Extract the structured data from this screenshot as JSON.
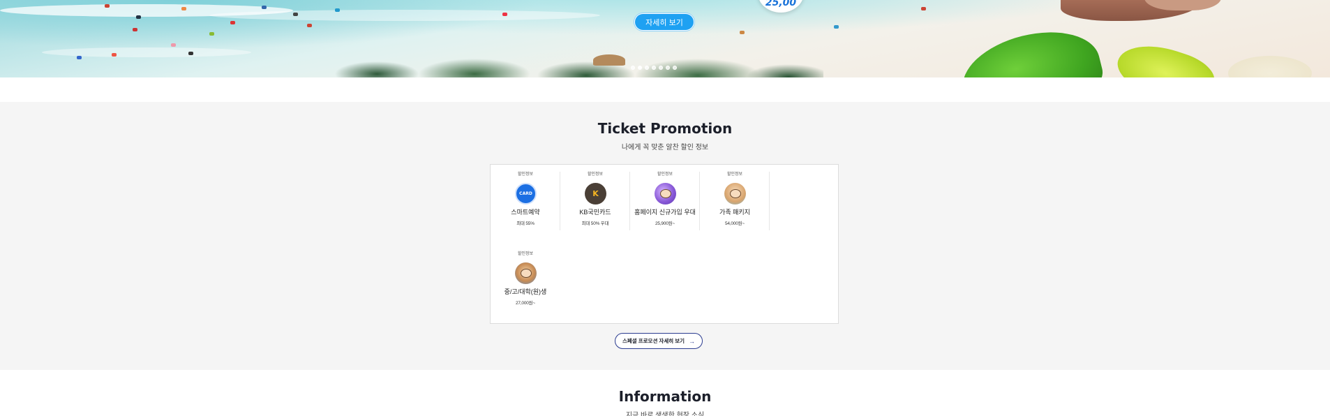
{
  "hero": {
    "cta_label": "자세히 보기",
    "price_text": "25,00",
    "slide_count": 7,
    "active_slide": 1
  },
  "promotion": {
    "title": "Ticket Promotion",
    "subtitle": "나에게 꼭 맞춘 알찬 할인 정보",
    "items": [
      {
        "tag": "할인정보",
        "name": "스마트예약",
        "detail": "최대 55%",
        "icon": "card-icon",
        "icon_text": "CARD"
      },
      {
        "tag": "할인정보",
        "name": "KB국민카드",
        "detail": "최대 50% 우대",
        "icon": "kb-logo-icon",
        "icon_text": "K"
      },
      {
        "tag": "할인정보",
        "name": "홈페이지 신규가입 우대",
        "detail": "25,900원~",
        "icon": "new-member-icon"
      },
      {
        "tag": "할인정보",
        "name": "가족 패키지",
        "detail": "54,000원~",
        "icon": "family-icon"
      },
      {
        "tag": "할인정보",
        "name": "중/고/대학(원)생",
        "detail": "27,000원~",
        "icon": "student-icon"
      }
    ],
    "more_label": "스페셜 프로모션 자세히 보기",
    "more_arrow": "→"
  },
  "information": {
    "title": "Information",
    "subtitle": "지금 바로 생생한 현장 소식"
  },
  "colors": {
    "accent": "#1ea1f2",
    "navy": "#2a3b8f",
    "section_bg": "#f5f5f5"
  }
}
